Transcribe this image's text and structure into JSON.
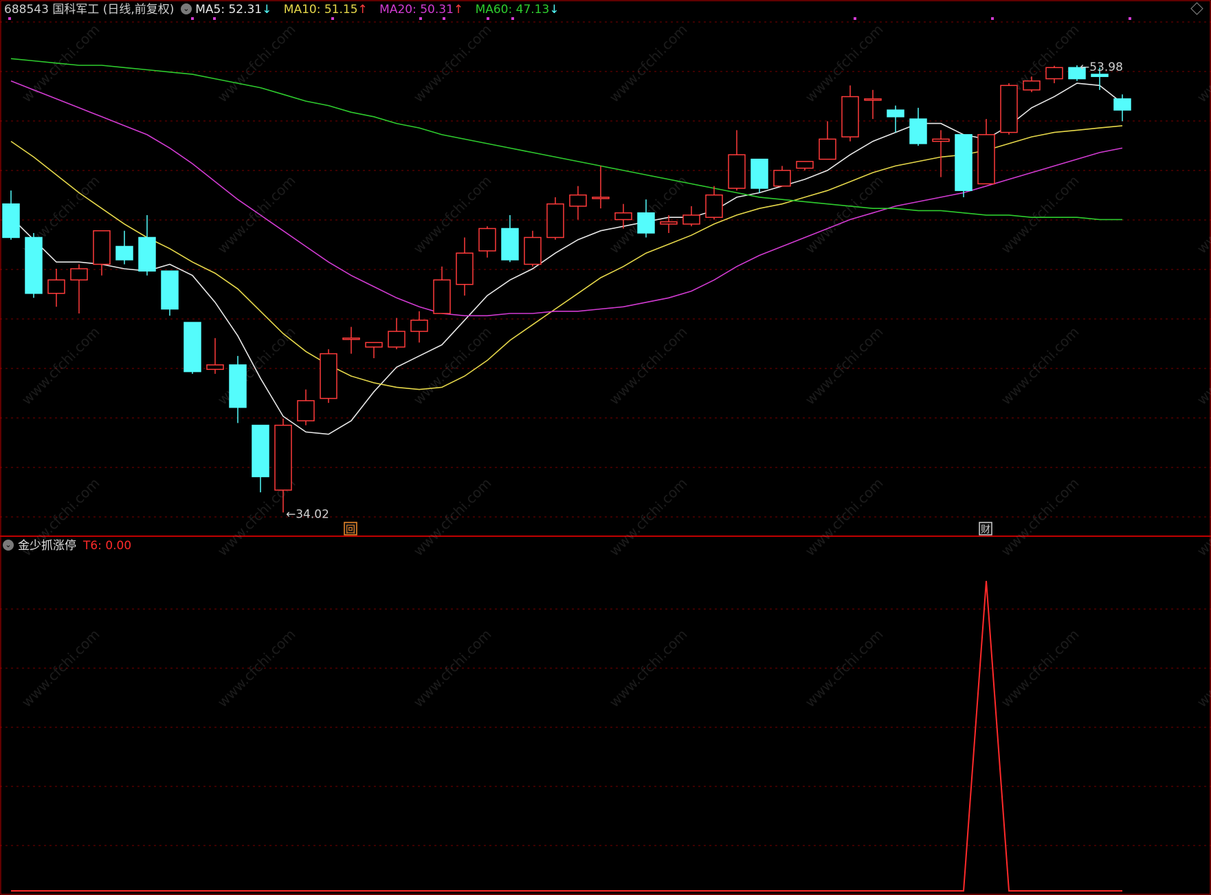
{
  "header": {
    "symbol": "688543",
    "name": "国科军工",
    "period": "(日线,前复权)",
    "ma5": {
      "label": "MA5: 52.31",
      "arrow": "↓",
      "color": "#e8e8e8"
    },
    "ma10": {
      "label": "MA10: 51.15",
      "arrow": "↑",
      "color": "#e6d84a"
    },
    "ma20": {
      "label": "MA20: 50.31",
      "arrow": "↑",
      "color": "#d23bd2"
    },
    "ma60": {
      "label": "MA60: 47.13",
      "arrow": "↓",
      "color": "#2ecc2e"
    }
  },
  "indicator": {
    "name": "金少抓涨停",
    "value_label": "T6: 0.00",
    "color": "#ff2a2a"
  },
  "markers": {
    "event_a": "回",
    "event_b": "财"
  },
  "colors": {
    "up": "#ff3b3b",
    "down": "#54fcfc",
    "grid": "#7a0000",
    "divider": "#c00000",
    "text": "#cfcfcf"
  },
  "watermark": "www.cfchi.com",
  "chart_data": [
    {
      "type": "candlestick",
      "y_range": [
        33,
        56
      ],
      "high_label": "53.98",
      "low_label": "34.02",
      "candles": [
        {
          "o": 47.8,
          "c": 46.3,
          "h": 48.4,
          "l": 46.2
        },
        {
          "o": 46.3,
          "c": 43.8,
          "h": 46.5,
          "l": 43.6
        },
        {
          "o": 43.8,
          "c": 44.4,
          "h": 44.9,
          "l": 43.2
        },
        {
          "o": 44.4,
          "c": 44.9,
          "h": 45.1,
          "l": 42.9
        },
        {
          "o": 45.1,
          "c": 46.6,
          "h": 46.6,
          "l": 44.6
        },
        {
          "o": 45.9,
          "c": 45.3,
          "h": 46.6,
          "l": 45.1
        },
        {
          "o": 46.3,
          "c": 44.8,
          "h": 47.3,
          "l": 44.6
        },
        {
          "o": 44.8,
          "c": 43.1,
          "h": 44.8,
          "l": 42.8
        },
        {
          "o": 42.5,
          "c": 40.3,
          "h": 42.5,
          "l": 40.2
        },
        {
          "o": 40.4,
          "c": 40.6,
          "h": 41.8,
          "l": 40.2
        },
        {
          "o": 40.6,
          "c": 38.7,
          "h": 41.0,
          "l": 38.0
        },
        {
          "o": 37.9,
          "c": 35.6,
          "h": 37.9,
          "l": 34.9
        },
        {
          "o": 35.0,
          "c": 37.9,
          "h": 38.2,
          "l": 34.0
        },
        {
          "o": 38.1,
          "c": 39.0,
          "h": 39.5,
          "l": 37.9
        },
        {
          "o": 39.1,
          "c": 41.1,
          "h": 41.3,
          "l": 38.9
        },
        {
          "o": 41.8,
          "c": 41.8,
          "h": 42.3,
          "l": 41.1
        },
        {
          "o": 41.4,
          "c": 41.6,
          "h": 41.6,
          "l": 40.9
        },
        {
          "o": 41.4,
          "c": 42.1,
          "h": 42.7,
          "l": 41.3
        },
        {
          "o": 42.1,
          "c": 42.6,
          "h": 43.0,
          "l": 41.6
        },
        {
          "o": 42.9,
          "c": 44.4,
          "h": 45.0,
          "l": 42.9
        },
        {
          "o": 44.2,
          "c": 45.6,
          "h": 46.3,
          "l": 43.7
        },
        {
          "o": 45.7,
          "c": 46.7,
          "h": 46.8,
          "l": 45.4
        },
        {
          "o": 46.7,
          "c": 45.3,
          "h": 47.3,
          "l": 45.2
        },
        {
          "o": 45.1,
          "c": 46.3,
          "h": 46.6,
          "l": 45.0
        },
        {
          "o": 46.3,
          "c": 47.8,
          "h": 48.1,
          "l": 46.2
        },
        {
          "o": 47.7,
          "c": 48.2,
          "h": 48.6,
          "l": 47.1
        },
        {
          "o": 48.1,
          "c": 48.1,
          "h": 49.5,
          "l": 47.6
        },
        {
          "o": 47.1,
          "c": 47.4,
          "h": 47.8,
          "l": 46.7
        },
        {
          "o": 47.4,
          "c": 46.5,
          "h": 48.0,
          "l": 46.3
        },
        {
          "o": 46.9,
          "c": 47.0,
          "h": 47.3,
          "l": 46.5
        },
        {
          "o": 46.9,
          "c": 47.3,
          "h": 47.7,
          "l": 46.8
        },
        {
          "o": 47.2,
          "c": 48.2,
          "h": 48.6,
          "l": 47.1
        },
        {
          "o": 48.5,
          "c": 50.0,
          "h": 51.1,
          "l": 48.4
        },
        {
          "o": 49.8,
          "c": 48.5,
          "h": 49.8,
          "l": 48.3
        },
        {
          "o": 48.6,
          "c": 49.3,
          "h": 49.5,
          "l": 48.6
        },
        {
          "o": 49.4,
          "c": 49.7,
          "h": 49.7,
          "l": 49.3
        },
        {
          "o": 49.8,
          "c": 50.7,
          "h": 51.5,
          "l": 49.8
        },
        {
          "o": 50.8,
          "c": 52.6,
          "h": 53.1,
          "l": 50.6
        },
        {
          "o": 52.5,
          "c": 52.5,
          "h": 52.9,
          "l": 51.6
        },
        {
          "o": 52.0,
          "c": 51.7,
          "h": 52.2,
          "l": 51.0
        },
        {
          "o": 51.6,
          "c": 50.5,
          "h": 52.1,
          "l": 50.4
        },
        {
          "o": 50.6,
          "c": 50.7,
          "h": 51.1,
          "l": 49.0
        },
        {
          "o": 50.9,
          "c": 48.4,
          "h": 50.9,
          "l": 48.1
        },
        {
          "o": 48.7,
          "c": 50.9,
          "h": 51.6,
          "l": 48.7
        },
        {
          "o": 51.0,
          "c": 53.1,
          "h": 53.2,
          "l": 50.9
        },
        {
          "o": 52.9,
          "c": 53.3,
          "h": 53.5,
          "l": 52.8
        },
        {
          "o": 53.4,
          "c": 53.9,
          "h": 53.98,
          "l": 53.2
        },
        {
          "o": 53.9,
          "c": 53.4,
          "h": 54.0,
          "l": 53.3
        },
        {
          "o": 53.6,
          "c": 53.5,
          "h": 53.9,
          "l": 52.9
        },
        {
          "o": 52.5,
          "c": 52.0,
          "h": 52.7,
          "l": 51.5
        }
      ],
      "series": [
        {
          "name": "MA5",
          "color": "#e8e8e8",
          "values": [
            47.2,
            46.2,
            45.2,
            45.2,
            45.1,
            44.9,
            44.8,
            45.1,
            44.6,
            43.4,
            41.9,
            40.0,
            38.3,
            37.6,
            37.5,
            38.1,
            39.4,
            40.5,
            41.0,
            41.5,
            42.6,
            43.7,
            44.4,
            44.9,
            45.6,
            46.2,
            46.6,
            46.8,
            47.0,
            47.2,
            47.2,
            47.5,
            48.1,
            48.3,
            48.6,
            48.9,
            49.3,
            50.0,
            50.6,
            51.0,
            51.4,
            51.4,
            50.9,
            50.7,
            51.3,
            52.1,
            52.6,
            53.2,
            53.1,
            52.3
          ]
        },
        {
          "name": "MA10",
          "color": "#e6d84a",
          "values": [
            50.6,
            49.9,
            49.1,
            48.3,
            47.6,
            46.9,
            46.3,
            45.8,
            45.2,
            44.7,
            44.0,
            43.0,
            42.0,
            41.2,
            40.6,
            40.1,
            39.8,
            39.6,
            39.5,
            39.6,
            40.1,
            40.8,
            41.7,
            42.4,
            43.1,
            43.8,
            44.5,
            45.0,
            45.6,
            46.0,
            46.4,
            46.9,
            47.3,
            47.6,
            47.8,
            48.1,
            48.4,
            48.8,
            49.2,
            49.5,
            49.7,
            49.9,
            50.0,
            50.2,
            50.5,
            50.8,
            51.0,
            51.1,
            51.2,
            51.3
          ]
        },
        {
          "name": "MA20",
          "color": "#d23bd2",
          "values": [
            53.3,
            52.9,
            52.5,
            52.1,
            51.7,
            51.3,
            50.9,
            50.3,
            49.6,
            48.8,
            48.0,
            47.3,
            46.6,
            45.9,
            45.2,
            44.6,
            44.1,
            43.6,
            43.2,
            42.9,
            42.8,
            42.8,
            42.9,
            42.9,
            43.0,
            43.0,
            43.1,
            43.2,
            43.4,
            43.6,
            43.9,
            44.4,
            45.0,
            45.5,
            45.9,
            46.3,
            46.7,
            47.1,
            47.4,
            47.7,
            47.9,
            48.1,
            48.3,
            48.6,
            48.9,
            49.2,
            49.5,
            49.8,
            50.1,
            50.3
          ]
        },
        {
          "name": "MA60",
          "color": "#2ecc2e",
          "values": [
            54.3,
            54.2,
            54.1,
            54.0,
            54.0,
            53.9,
            53.8,
            53.7,
            53.6,
            53.4,
            53.2,
            53.0,
            52.7,
            52.4,
            52.2,
            51.9,
            51.7,
            51.4,
            51.2,
            50.9,
            50.7,
            50.5,
            50.3,
            50.1,
            49.9,
            49.7,
            49.5,
            49.3,
            49.1,
            48.9,
            48.7,
            48.5,
            48.3,
            48.1,
            48.0,
            47.9,
            47.8,
            47.7,
            47.6,
            47.6,
            47.5,
            47.5,
            47.4,
            47.3,
            47.3,
            47.2,
            47.2,
            47.2,
            47.1,
            47.1
          ]
        }
      ]
    },
    {
      "type": "line",
      "name": "T6",
      "color": "#ff2a2a",
      "y_range": [
        0,
        1.1
      ],
      "values": [
        0,
        0,
        0,
        0,
        0,
        0,
        0,
        0,
        0,
        0,
        0,
        0,
        0,
        0,
        0,
        0,
        0,
        0,
        0,
        0,
        0,
        0,
        0,
        0,
        0,
        0,
        0,
        0,
        0,
        0,
        0,
        0,
        0,
        0,
        0,
        0,
        0,
        0,
        0,
        0,
        0,
        0,
        0,
        1,
        0,
        0,
        0,
        0,
        0,
        0
      ]
    }
  ]
}
